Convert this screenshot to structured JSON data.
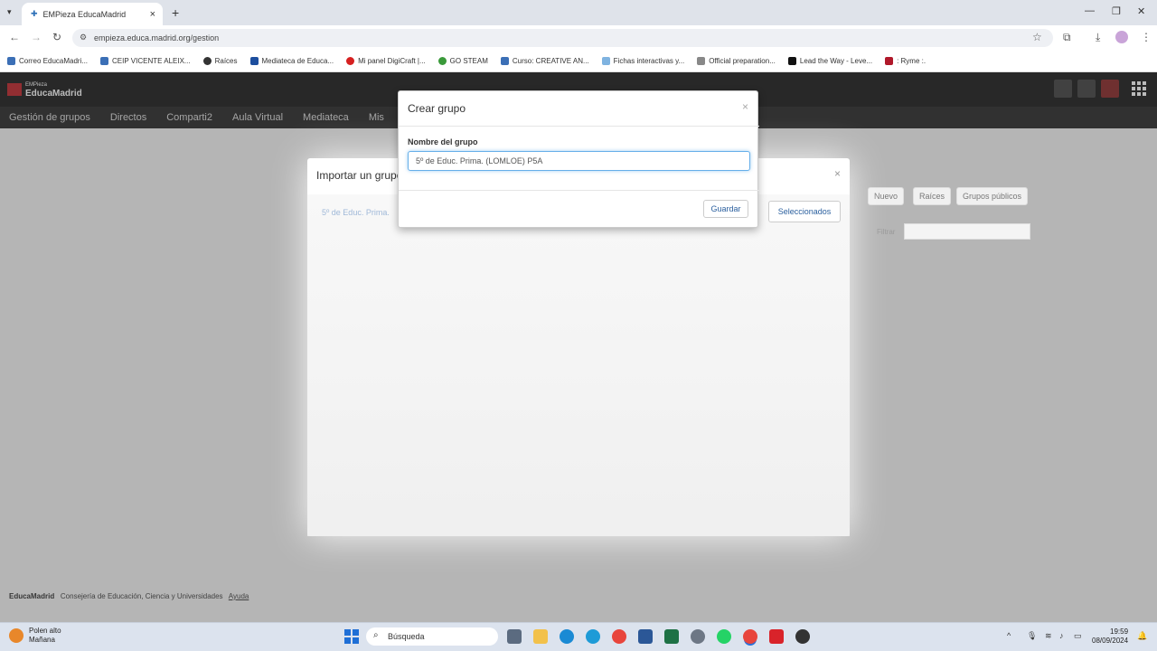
{
  "browser": {
    "tab_title": "EMPieza EducaMadrid",
    "url": "empieza.educa.madrid.org/gestion",
    "bookmarks": [
      "Correo EducaMadri...",
      "CEIP VICENTE ALEIX...",
      "Raíces",
      "Mediateca de Educa...",
      "Mi panel DigiCraft |...",
      "GO STEAM",
      "Curso: CREATIVE AN...",
      "Fichas interactivas y...",
      "Official preparation...",
      "Lead the Way - Leve...",
      ": Ryme :."
    ]
  },
  "app": {
    "logo_small": "EMPieza",
    "logo": "EducaMadrid",
    "nav": [
      "Gestión de grupos",
      "Directos",
      "Comparti2",
      "Aula Virtual",
      "Mediateca",
      "Mis"
    ]
  },
  "bg_modal": {
    "title": "Importar un grupo",
    "blur_text": "5º de Educ. Prima.",
    "selected_button": "Seleccionados",
    "side_buttons": [
      "Nuevo",
      "Raíces",
      "Grupos públicos"
    ],
    "filter_label": "Filtrar"
  },
  "modal": {
    "title": "Crear grupo",
    "field_label": "Nombre del grupo",
    "input_value": "5º de Educ. Prima. (LOMLOE) P5A",
    "save_label": "Guardar"
  },
  "footer": {
    "brand": "EducaMadrid",
    "text": "Consejería de Educación, Ciencia y Universidades",
    "link": "Ayuda"
  },
  "taskbar": {
    "weather_title": "Polen alto",
    "weather_sub": "Mañana",
    "search_placeholder": "Búsqueda",
    "time": "19:59",
    "date": "08/09/2024"
  }
}
